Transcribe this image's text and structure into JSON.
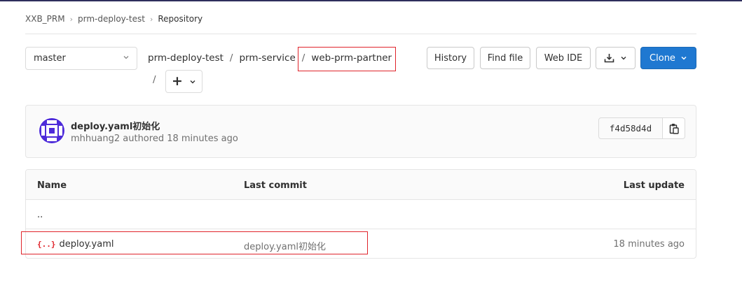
{
  "breadcrumb": {
    "group": "XXB_PRM",
    "project": "prm-deploy-test",
    "current": "Repository"
  },
  "branch": {
    "selected": "master"
  },
  "path": {
    "segments": [
      "prm-deploy-test",
      "prm-service",
      "web-prm-partner"
    ],
    "separator": "/"
  },
  "buttons": {
    "history": "History",
    "find_file": "Find file",
    "web_ide": "Web IDE",
    "clone": "Clone"
  },
  "commit": {
    "title": "deploy.yaml初始化",
    "author": "mhhuang2",
    "authored": "authored",
    "time": "18 minutes ago",
    "sha": "f4d58d4d"
  },
  "table": {
    "headers": {
      "name": "Name",
      "last_commit": "Last commit",
      "last_update": "Last update"
    },
    "parent": "..",
    "rows": [
      {
        "icon_text": "{..}",
        "name": "deploy.yaml",
        "last_commit": "deploy.yaml初始化",
        "last_update": "18 minutes ago"
      }
    ]
  },
  "colors": {
    "primary": "#1f78d1",
    "highlight": "#e0242b"
  },
  "icons": {
    "branch_chevron": "chevron-down-icon",
    "add": "plus-icon",
    "download": "download-icon",
    "copy": "copy-icon",
    "avatar": "identicon-avatar",
    "file": "yaml-file-icon"
  }
}
